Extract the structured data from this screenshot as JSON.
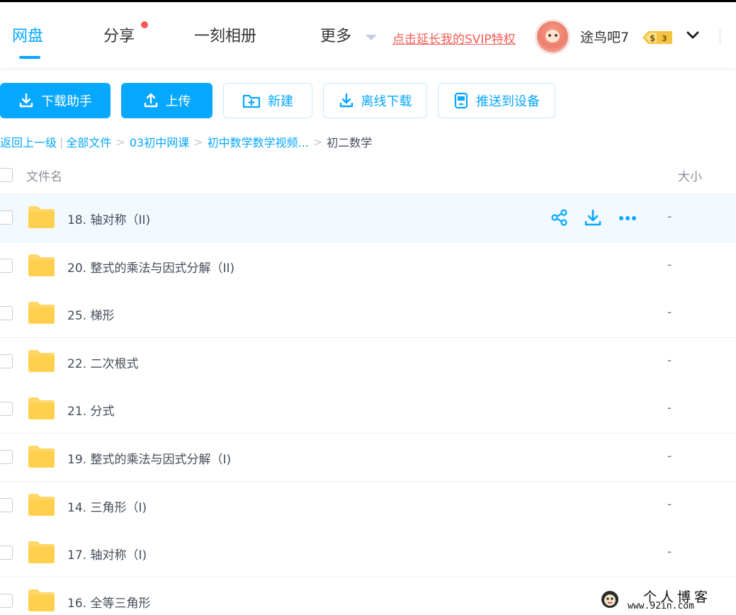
{
  "header": {
    "tabs": [
      {
        "label": "网盘",
        "active": true
      },
      {
        "label": "分享",
        "badge_dot": true
      },
      {
        "label": "一刻相册"
      },
      {
        "label": "更多"
      }
    ],
    "svip_link": "点击延长我的SVIP特权",
    "username": "途鸟吧7",
    "vip_badge": {
      "symbol": "$",
      "level": "3"
    },
    "icons": [
      "avatar",
      "vip-badge-icon",
      "chevron-down-icon"
    ]
  },
  "toolbar": {
    "buttons": [
      {
        "label": "下载助手",
        "icon": "download-icon"
      },
      {
        "label": "上传",
        "icon": "upload-icon"
      },
      {
        "label": "新建",
        "icon": "new-folder-icon"
      },
      {
        "label": "离线下载",
        "icon": "download-icon"
      },
      {
        "label": "推送到设备",
        "icon": "device-icon"
      }
    ]
  },
  "breadcrumb": {
    "back": "返回上一级",
    "separator_bar": "|",
    "separator": ">",
    "items": [
      "全部文件",
      "03初中网课",
      "初中数学数学视频...",
      "初二数学"
    ]
  },
  "columns": {
    "name": "文件名",
    "size": "大小"
  },
  "files": [
    {
      "name": "18. 轴对称（II)",
      "size": "-",
      "hovered": true
    },
    {
      "name": "20. 整式的乘法与因式分解（II)",
      "size": "-"
    },
    {
      "name": "25. 梯形",
      "size": "-"
    },
    {
      "name": "22. 二次根式",
      "size": "-"
    },
    {
      "name": "21. 分式",
      "size": "-"
    },
    {
      "name": "19. 整式的乘法与因式分解（I)",
      "size": "-"
    },
    {
      "name": "14. 三角形（I)",
      "size": "-"
    },
    {
      "name": "17. 轴对称（I)",
      "size": "-"
    },
    {
      "name": "16. 全等三角形",
      "size": "-"
    }
  ],
  "row_actions": [
    "share-icon",
    "download-icon",
    "more-icon"
  ],
  "watermark": {
    "title": "个人博客",
    "url": "www.92in.com"
  },
  "colors": {
    "accent": "#06a7ff",
    "svip_red": "#f35b55",
    "folder_yellow": "#ffd766",
    "hover_row": "#f3faff",
    "text": "#454d5a"
  }
}
